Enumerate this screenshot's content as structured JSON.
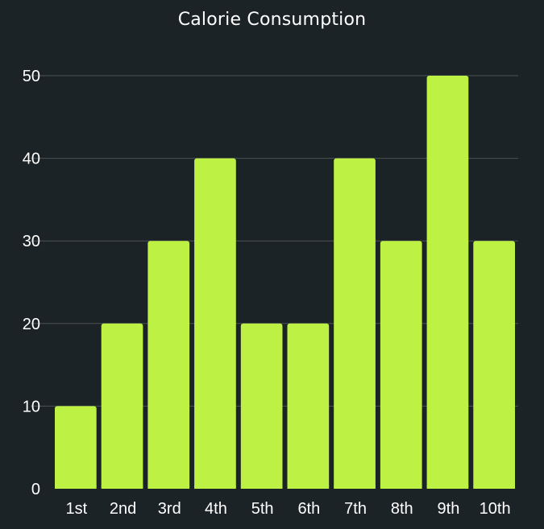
{
  "chart_data": {
    "type": "bar",
    "title": "Calorie Consumption",
    "xlabel": "",
    "ylabel": "",
    "categories": [
      "1st",
      "2nd",
      "3rd",
      "4th",
      "5th",
      "6th",
      "7th",
      "8th",
      "9th",
      "10th"
    ],
    "values": [
      10,
      20,
      30,
      40,
      20,
      20,
      40,
      30,
      50,
      30
    ],
    "ylim": [
      0,
      50
    ],
    "yticks": [
      "0",
      "10",
      "20",
      "30",
      "40",
      "50"
    ],
    "grid": true,
    "legend": "none",
    "colors": {
      "background": "#1c2326",
      "bar": "#bdf244",
      "grid": "#4a5356",
      "text": "#ffffff"
    }
  }
}
